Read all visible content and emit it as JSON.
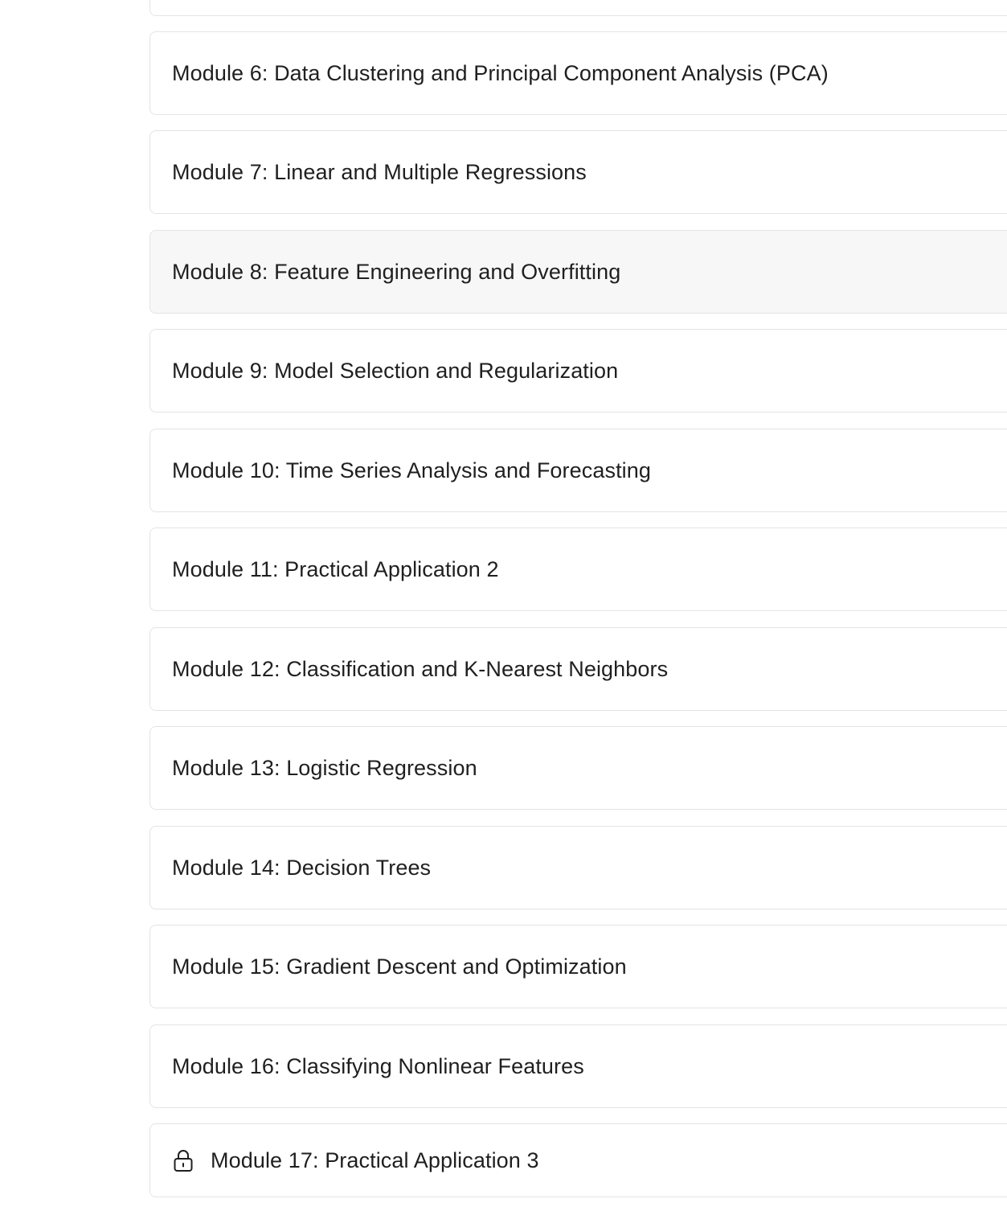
{
  "modules": [
    {
      "title": ""
    },
    {
      "title": "Module 6: Data Clustering and Principal Component Analysis (PCA)"
    },
    {
      "title": "Module 7: Linear and Multiple Regressions"
    },
    {
      "title": "Module 8: Feature Engineering and Overfitting"
    },
    {
      "title": "Module 9: Model Selection and Regularization"
    },
    {
      "title": "Module 10: Time Series Analysis and Forecasting"
    },
    {
      "title": "Module 11: Practical Application 2"
    },
    {
      "title": "Module 12: Classification and K-Nearest Neighbors"
    },
    {
      "title": "Module 13: Logistic Regression"
    },
    {
      "title": "Module 14: Decision Trees"
    },
    {
      "title": "Module 15: Gradient Descent and Optimization"
    },
    {
      "title": "Module 16: Classifying Nonlinear Features"
    },
    {
      "title": "Module 17: Practical Application 3",
      "icon": "lock-icon"
    }
  ]
}
